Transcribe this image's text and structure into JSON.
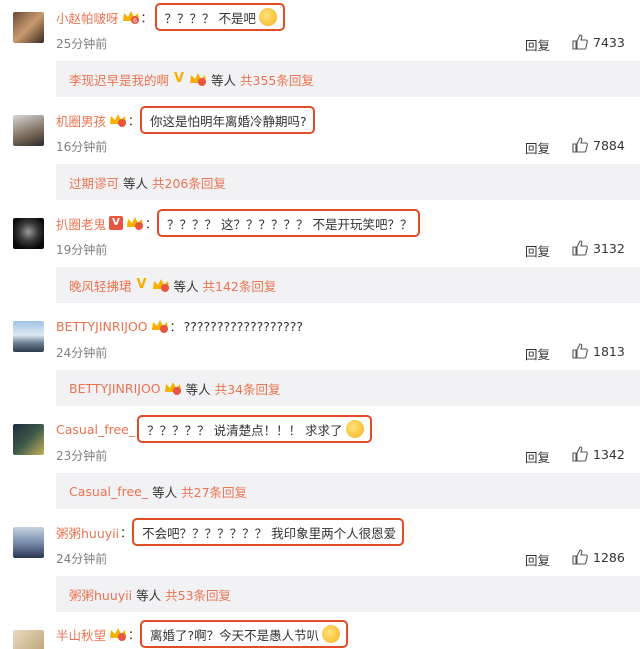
{
  "comments": [
    {
      "user": "小赵帕啵呀",
      "text": "？？？？ 不是吧",
      "time": "25分钟前",
      "reply_label": "回复",
      "likes": "7433",
      "thread": {
        "names": "李现迟早是我的啊",
        "suffix": "等人",
        "count": "共355条回复"
      }
    },
    {
      "user": "机圈男孩",
      "text": "你这是怕明年离婚冷静期吗?",
      "time": "16分钟前",
      "reply_label": "回复",
      "likes": "7884",
      "thread": {
        "names": "过期谬可",
        "suffix": "等人",
        "count": "共206条回复"
      }
    },
    {
      "user": "扒圈老鬼",
      "text": "？？？？ 这？？？？？？ 不是开玩笑吧？？",
      "time": "19分钟前",
      "reply_label": "回复",
      "likes": "3132",
      "thread": {
        "names": "晚风轻拂珺",
        "suffix": "等人",
        "count": "共142条回复"
      }
    },
    {
      "user": "BETTYJINRIJOO",
      "text": "??????????????????",
      "time": "24分钟前",
      "reply_label": "回复",
      "likes": "1813",
      "thread": {
        "names": "BETTYJINRIJOO",
        "suffix": "等人",
        "count": "共34条回复"
      }
    },
    {
      "user": "Casual_free_",
      "text": "？？？？？ 说清楚点！！！ 求求了",
      "time": "23分钟前",
      "reply_label": "回复",
      "likes": "1342",
      "thread": {
        "names": "Casual_free_",
        "suffix": "等人",
        "count": "共27条回复"
      }
    },
    {
      "user": "粥粥huuyii",
      "text": "不会吧？？？？？？？ 我印象里两个人很恩爱",
      "time": "24分钟前",
      "reply_label": "回复",
      "likes": "1286",
      "thread": {
        "names": "粥粥huuyii",
        "suffix": "等人",
        "count": "共53条回复"
      }
    },
    {
      "user": "半山秋望",
      "text": "离婚了?啊？今天不是愚人节叭"
    }
  ],
  "icons": {
    "vip_badge": "crown-vip-badge",
    "verified": "v-verified-badge",
    "like": "thumbs-up-icon",
    "emoji": "emoji-face"
  },
  "colors": {
    "username": "#eb7350",
    "highlight_box": "#e14b25",
    "thread_bg": "#f2f2f5",
    "vip": "#f7b000"
  }
}
